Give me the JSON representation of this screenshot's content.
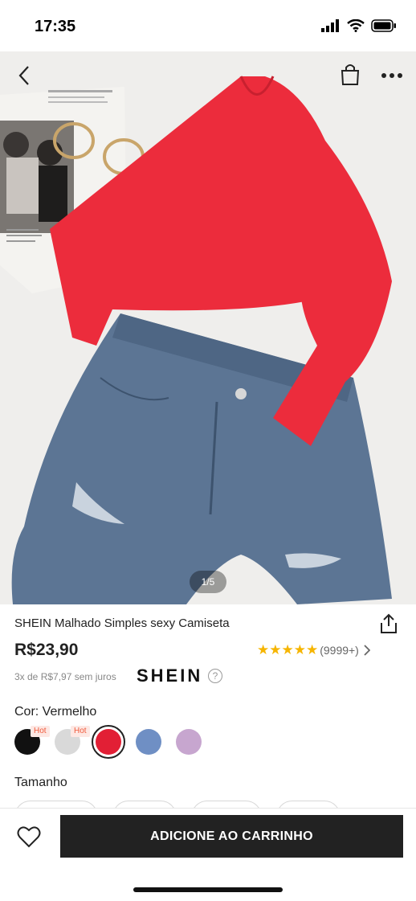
{
  "status": {
    "time": "17:35"
  },
  "gallery": {
    "indicator": "1/5"
  },
  "product": {
    "title": "SHEIN Malhado Simples sexy Camiseta",
    "price": "R$23,90",
    "stars": "★★★★★",
    "rating_count": "(9999+)",
    "installments": "3x de R$7,97 sem juros",
    "brand": "SHEIN"
  },
  "color": {
    "label": "Cor: Vermelho",
    "swatches": [
      {
        "name": "black",
        "hex": "#111111",
        "badge": "Hot"
      },
      {
        "name": "light-gray",
        "hex": "#d9d9d9",
        "badge": "Hot"
      },
      {
        "name": "red",
        "hex": "#e21f35",
        "selected": true
      },
      {
        "name": "blue",
        "hex": "#6f8fc4"
      },
      {
        "name": "lilac",
        "hex": "#c7a6cf"
      }
    ]
  },
  "size": {
    "label": "Tamanho"
  },
  "actions": {
    "add_to_cart": "ADICIONE AO CARRINHO"
  },
  "colors": {
    "accent_star": "#f6b500",
    "button_bg": "#222222"
  },
  "icons": [
    "back-arrow-icon",
    "shopping-bag-icon",
    "more-icon",
    "share-icon",
    "chevron-right-icon",
    "help-icon",
    "heart-icon"
  ]
}
